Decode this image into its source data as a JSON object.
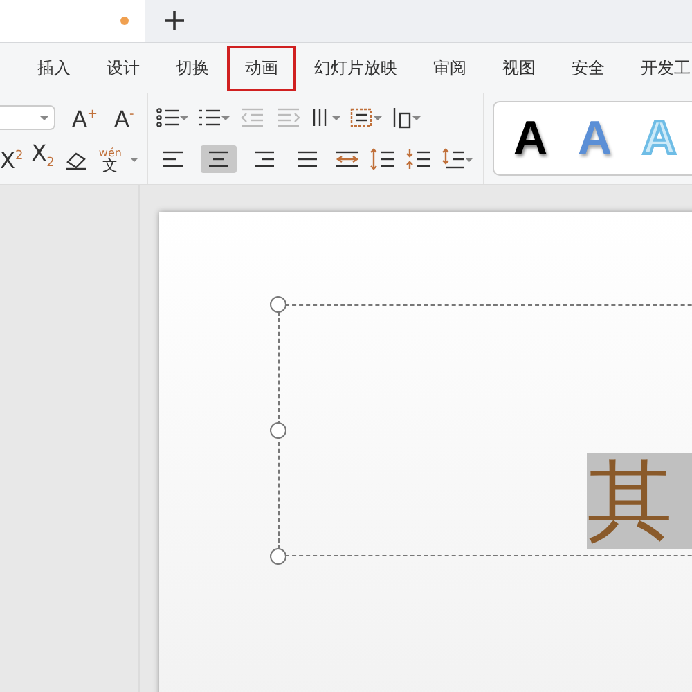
{
  "document_tab": {
    "unsaved": true
  },
  "menu": [
    {
      "label": "插入",
      "highlighted": false
    },
    {
      "label": "设计",
      "highlighted": false
    },
    {
      "label": "切换",
      "highlighted": false
    },
    {
      "label": "动画",
      "highlighted": true
    },
    {
      "label": "幻灯片放映",
      "highlighted": false
    },
    {
      "label": "审阅",
      "highlighted": false
    },
    {
      "label": "视图",
      "highlighted": false
    },
    {
      "label": "安全",
      "highlighted": false
    },
    {
      "label": "开发工",
      "highlighted": false
    }
  ],
  "font_tools": {
    "grow": "A$^{+}$",
    "shrink": "A$^{-}$",
    "superscript": "X$^{2}$",
    "subscript": "X$_{2}$",
    "pinyin_top": "wén",
    "pinyin_bottom": "文"
  },
  "alignment": [
    {
      "kind": "left",
      "selected": false
    },
    {
      "kind": "center",
      "selected": true
    },
    {
      "kind": "right",
      "selected": false
    },
    {
      "kind": "justify",
      "selected": false
    }
  ],
  "style_gallery": [
    {
      "letter": "A",
      "kind": "solid-black"
    },
    {
      "letter": "A",
      "kind": "solid-blue"
    },
    {
      "letter": "A",
      "kind": "outline-blue"
    }
  ],
  "slide": {
    "text": "其",
    "text_selected": true
  }
}
